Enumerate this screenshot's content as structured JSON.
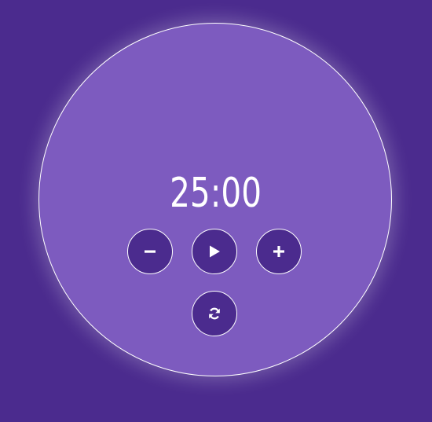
{
  "timer": {
    "time": "25:00"
  },
  "controls": {
    "decrease_icon": "minus-icon",
    "start_icon": "play-icon",
    "increase_icon": "plus-icon",
    "reset_icon": "refresh-icon"
  },
  "colors": {
    "background": "#4b2b8e",
    "face": "#7d5bbf",
    "button": "#4b2b8e",
    "foreground": "#ffffff"
  }
}
